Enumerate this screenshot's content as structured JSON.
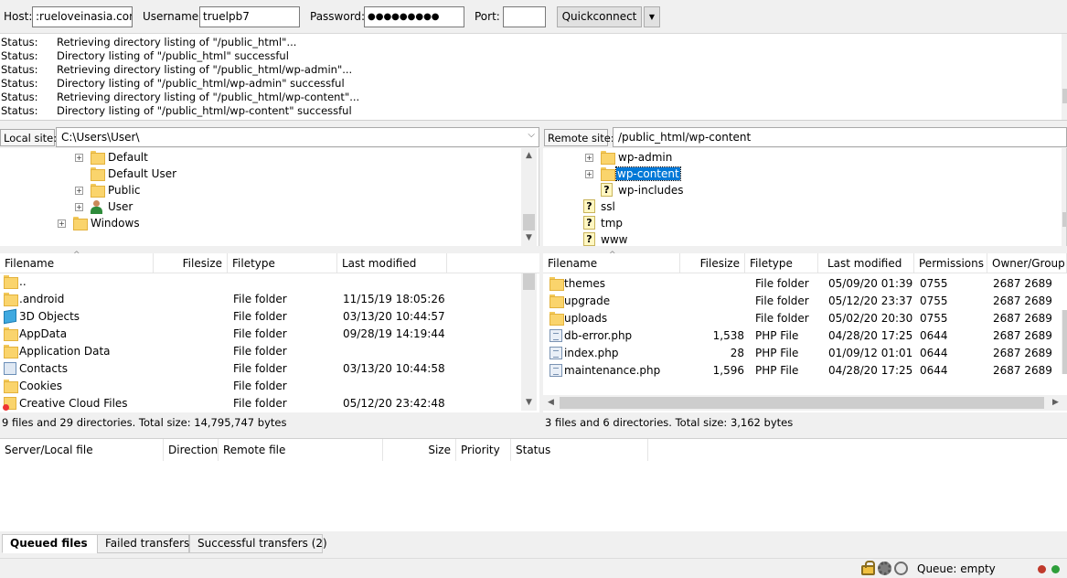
{
  "quickconnect": {
    "host_label": "Host:",
    "host_value": ":rueloveinasia.com",
    "username_label": "Username:",
    "username_value": "truelpb7",
    "password_label": "Password:",
    "password_value": "●●●●●●●●●",
    "port_label": "Port:",
    "port_value": "",
    "button_label": "Quickconnect",
    "dropdown_arrow": "▼"
  },
  "log": [
    {
      "kind": "Status:",
      "text": "Retrieving directory listing of \"/public_html\"..."
    },
    {
      "kind": "Status:",
      "text": "Directory listing of \"/public_html\" successful"
    },
    {
      "kind": "Status:",
      "text": "Retrieving directory listing of \"/public_html/wp-admin\"..."
    },
    {
      "kind": "Status:",
      "text": "Directory listing of \"/public_html/wp-admin\" successful"
    },
    {
      "kind": "Status:",
      "text": "Retrieving directory listing of \"/public_html/wp-content\"..."
    },
    {
      "kind": "Status:",
      "text": "Directory listing of \"/public_html/wp-content\" successful"
    }
  ],
  "local": {
    "site_label": "Local site:",
    "path": "C:\\Users\\User\\",
    "tree": [
      "Default",
      "Default User",
      "Public",
      "User",
      "Windows"
    ],
    "headers": {
      "filename": "Filename",
      "filesize": "Filesize",
      "filetype": "Filetype",
      "modified": "Last modified"
    },
    "files": [
      {
        "name": "..",
        "size": "",
        "type": "",
        "modified": "",
        "icon": "folder"
      },
      {
        "name": ".android",
        "size": "",
        "type": "File folder",
        "modified": "11/15/19 18:05:26",
        "icon": "folder"
      },
      {
        "name": "3D Objects",
        "size": "",
        "type": "File folder",
        "modified": "03/13/20 10:44:57",
        "icon": "3d-objects"
      },
      {
        "name": "AppData",
        "size": "",
        "type": "File folder",
        "modified": "09/28/19 14:19:44",
        "icon": "folder"
      },
      {
        "name": "Application Data",
        "size": "",
        "type": "File folder",
        "modified": "",
        "icon": "folder"
      },
      {
        "name": "Contacts",
        "size": "",
        "type": "File folder",
        "modified": "03/13/20 10:44:58",
        "icon": "contacts"
      },
      {
        "name": "Cookies",
        "size": "",
        "type": "File folder",
        "modified": "",
        "icon": "folder"
      },
      {
        "name": "Creative Cloud Files",
        "size": "",
        "type": "File folder",
        "modified": "05/12/20 23:42:48",
        "icon": "creative-cloud"
      }
    ],
    "summary": "9 files and 29 directories. Total size: 14,795,747 bytes"
  },
  "remote": {
    "site_label": "Remote site:",
    "path": "/public_html/wp-content",
    "tree": [
      "wp-admin",
      "wp-content",
      "wp-includes",
      "ssl",
      "tmp",
      "www"
    ],
    "headers": {
      "filename": "Filename",
      "filesize": "Filesize",
      "filetype": "Filetype",
      "modified": "Last modified",
      "permissions": "Permissions",
      "owner": "Owner/Group"
    },
    "files": [
      {
        "name": "themes",
        "size": "",
        "type": "File folder",
        "modified": "05/09/20 01:39:...",
        "perms": "0755",
        "owner": "2687 2689",
        "icon": "folder"
      },
      {
        "name": "upgrade",
        "size": "",
        "type": "File folder",
        "modified": "05/12/20 23:37:...",
        "perms": "0755",
        "owner": "2687 2689",
        "icon": "folder"
      },
      {
        "name": "uploads",
        "size": "",
        "type": "File folder",
        "modified": "05/02/20 20:30:...",
        "perms": "0755",
        "owner": "2687 2689",
        "icon": "folder"
      },
      {
        "name": "db-error.php",
        "size": "1,538",
        "type": "PHP File",
        "modified": "04/28/20 17:25:...",
        "perms": "0644",
        "owner": "2687 2689",
        "icon": "php-file"
      },
      {
        "name": "index.php",
        "size": "28",
        "type": "PHP File",
        "modified": "01/09/12 01:01:...",
        "perms": "0644",
        "owner": "2687 2689",
        "icon": "php-file"
      },
      {
        "name": "maintenance.php",
        "size": "1,596",
        "type": "PHP File",
        "modified": "04/28/20 17:25:...",
        "perms": "0644",
        "owner": "2687 2689",
        "icon": "php-file"
      }
    ],
    "summary": "3 files and 6 directories. Total size: 3,162 bytes"
  },
  "queue": {
    "headers": {
      "server": "Server/Local file",
      "direction": "Direction",
      "remote": "Remote file",
      "size": "Size",
      "priority": "Priority",
      "status": "Status"
    }
  },
  "tabs": [
    {
      "label": "Queued files",
      "active": true
    },
    {
      "label": "Failed transfers",
      "active": false
    },
    {
      "label": "Successful transfers (2)",
      "active": false
    }
  ],
  "statusbar": {
    "queue": "Queue: empty"
  },
  "colors": {
    "selection": "#0078d7",
    "led_red": "#c0392b",
    "led_green": "#2e9e3a"
  }
}
